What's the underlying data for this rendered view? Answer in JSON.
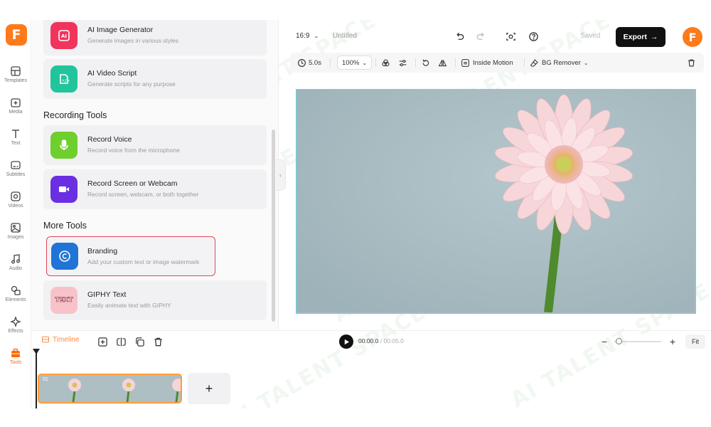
{
  "app": {
    "logo_letter": "F",
    "accent": "#ff7a1a"
  },
  "rail": [
    {
      "label": "Templates",
      "icon": "templates-icon"
    },
    {
      "label": "Media",
      "icon": "media-icon"
    },
    {
      "label": "Text",
      "icon": "text-icon"
    },
    {
      "label": "Subtitles",
      "icon": "subtitles-icon"
    },
    {
      "label": "Videos",
      "icon": "videos-icon"
    },
    {
      "label": "Images",
      "icon": "images-icon"
    },
    {
      "label": "Audio",
      "icon": "audio-icon"
    },
    {
      "label": "Elements",
      "icon": "elements-icon"
    },
    {
      "label": "Effects",
      "icon": "effects-icon"
    },
    {
      "label": "Tools",
      "icon": "tools-icon",
      "active": true
    }
  ],
  "panel": {
    "ai_tools": [
      {
        "title": "AI Image Generator",
        "desc": "Generate images in various styles",
        "color": "#f0345c",
        "icon": "ai-image-icon"
      },
      {
        "title": "AI Video Script",
        "desc": "Generate scripts for any purpose",
        "color": "#22c59b",
        "icon": "ai-script-icon"
      }
    ],
    "recording_title": "Recording Tools",
    "recording_tools": [
      {
        "title": "Record Voice",
        "desc": "Record voice from the microphone",
        "color": "#6fcf2c",
        "icon": "microphone-icon"
      },
      {
        "title": "Record Screen or Webcam",
        "desc": "Record screen, webcam, or both together",
        "color": "#6b2fe3",
        "icon": "webcam-icon"
      }
    ],
    "more_title": "More Tools",
    "more_tools": [
      {
        "title": "Branding",
        "desc": "Add your custom text or image watermark",
        "color": "#1f74d6",
        "icon": "copyright-icon"
      },
      {
        "title": "GIPHY Text",
        "desc": "Easily animate text with GIPHY",
        "color": "#f7c3c8",
        "icon": "giphy-text-icon",
        "badge": "TEXT"
      }
    ]
  },
  "topbar": {
    "aspect": "16:9",
    "title": "Untitled",
    "saved": "Saved",
    "export": "Export",
    "avatar_letter": "F"
  },
  "toolbar": {
    "duration": "5.0s",
    "zoom": "100%",
    "inside_motion": "Inside Motion",
    "bg_remover": "BG Remover"
  },
  "timeline": {
    "label": "Timeline",
    "current_time": "00:00.0",
    "total_time": "/ 00:05.0",
    "fit": "Fit",
    "clip_number": "01",
    "add_label": "+",
    "zoom_level": 0.05
  },
  "watermark_text": "AI TALENT SPACE",
  "colors": {
    "canvas_border": "#62d6e6",
    "clip_border": "#ff9d3a",
    "highlight_border": "#e0485a"
  }
}
